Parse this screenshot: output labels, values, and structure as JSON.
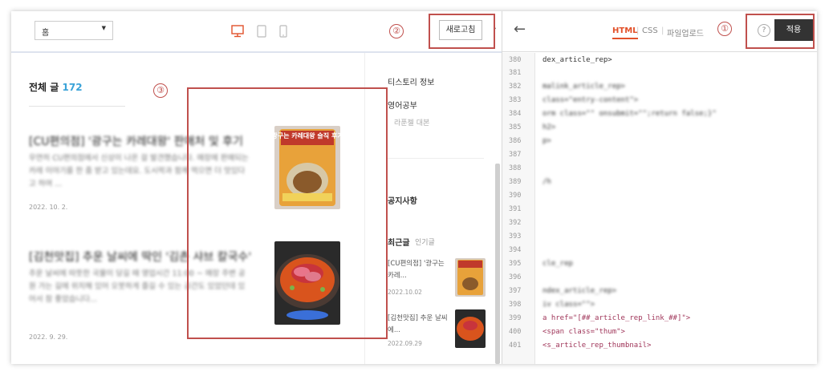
{
  "preview": {
    "skin_select": "홈",
    "refresh_label": "새로고침",
    "list_heading": "전체 글",
    "post_count": "172",
    "posts": [
      {
        "title": "[CU편의점] '광구는 카레대왕' 판매처 및 후기",
        "excerpt": "우연히 CU편의점에서 신상이 나온 걸 발견했습니다. 매장에 판매되는 카레 이야기를 한 줌 받고 있는데요. 도시락과 함께 먹으면 더 맛있다고 하여 ...",
        "date": "2022. 10. 2.",
        "thumb_text": "광구는 카레대왕 슬직 후기"
      },
      {
        "title": "[김천맛집] 추운 날씨에 딱인 '김촌 샤브 칼국수'",
        "excerpt": "추운 날씨에 따뜻한 국물이 당길 때 영업시간 11:00 ~ 매장 주변 공원 가는 길에 위치해 있어 오붓하게 즐길 수 있는 공간도 있었던데 있어서 참 좋았습니다...",
        "date": "2022. 9. 29."
      }
    ],
    "sidebar": {
      "blog_info": "티스토리 정보",
      "category": "영어공부",
      "category_sub": "라푼젤 대본",
      "notice": "공지사항",
      "tab_recent": "최근글",
      "tab_popular": "인기글",
      "recent": [
        {
          "title": "[CU편의점] '광구는 카레...",
          "date": "2022.10.02"
        },
        {
          "title": "[김천맛집] 추운 날씨에...",
          "date": "2022.09.29"
        }
      ]
    }
  },
  "editor": {
    "tabs": [
      "HTML",
      "CSS",
      "파일업로드"
    ],
    "help": "?",
    "apply_label": "적용",
    "line_numbers": [
      "380",
      "381",
      "382",
      "383",
      "384",
      "385",
      "386",
      "387",
      "388",
      "389",
      "390",
      "391",
      "392",
      "393",
      "394",
      "395",
      "396",
      "397",
      "398",
      "399",
      "400",
      "401"
    ],
    "visible_lines": {
      "l380": "dex_article_rep>",
      "l382": "malink_article_rep>",
      "l383": " class=\"entry-content\">",
      "l384": "orm class=\"\" onsubmit=\"\";return false;}\"",
      "l385": "h2>",
      "l386": "p>",
      "l389": "/h",
      "l392": "",
      "l395": "cle_rep",
      "l397": "ndex_article_rep>",
      "l398": "iv class=\"\">",
      "l399": "a href=\"[##_article_rep_link_##]\">",
      "l400": "  <span class=\"thum\">",
      "l401": "    <s_article_rep_thumbnail>"
    }
  },
  "markers": [
    "①",
    "②",
    "③"
  ]
}
